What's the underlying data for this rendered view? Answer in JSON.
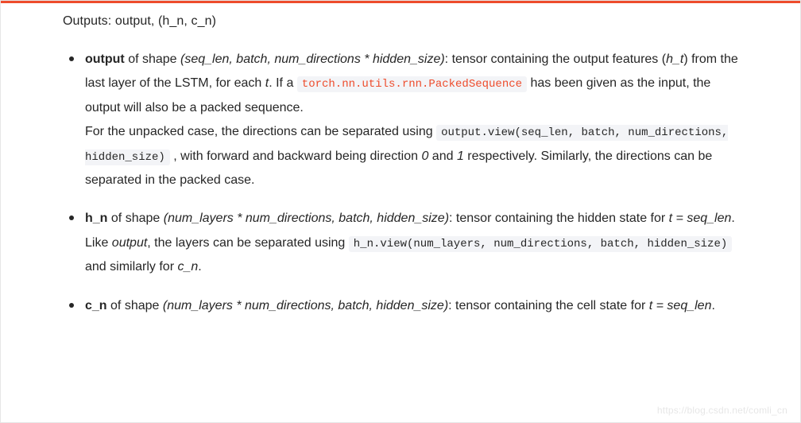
{
  "header": "Outputs: output, (h_n, c_n)",
  "items": [
    {
      "term": "output",
      "shape_prefix": " of shape ",
      "shape": "(seq_len, batch, num_directions * hidden_size)",
      "after_shape": ": tensor containing the output features (",
      "ht": "h_t",
      "after_ht": ") from the last layer of the LSTM, for each ",
      "t1": "t",
      "after_t1": ". If a ",
      "link_code": "torch.nn.utils.rnn.PackedSequence",
      "after_link": " has been given as the input, the output will also be a packed sequence.",
      "p2_a": "For the unpacked case, the directions can be separated using ",
      "code2": "output.view(seq_len, batch, num_directions, hidden_size)",
      "p2_b": " , with forward and backward being direction ",
      "zero": "0",
      "p2_c": " and ",
      "one": "1",
      "p2_d": " respectively. Similarly, the directions can be separated in the packed case."
    },
    {
      "term": "h_n",
      "shape_prefix": " of shape ",
      "shape": "(num_layers * num_directions, batch, hidden_size)",
      "after_shape": ": tensor containing the hidden state for ",
      "teq": "t = seq_len",
      "period": ".",
      "p2_a": "Like ",
      "outp": "output",
      "p2_b": ", the layers can be separated using ",
      "code2": "h_n.view(num_layers, num_directions, batch, hidden_size)",
      "p2_c": " and similarly for ",
      "cn": "c_n",
      "p2_d": "."
    },
    {
      "term": "c_n",
      "shape_prefix": " of shape ",
      "shape": "(num_layers * num_directions, batch, hidden_size)",
      "after_shape": ": tensor containing the cell state for ",
      "teq": "t = seq_len",
      "period": "."
    }
  ],
  "watermark": "https://blog.csdn.net/comli_cn"
}
